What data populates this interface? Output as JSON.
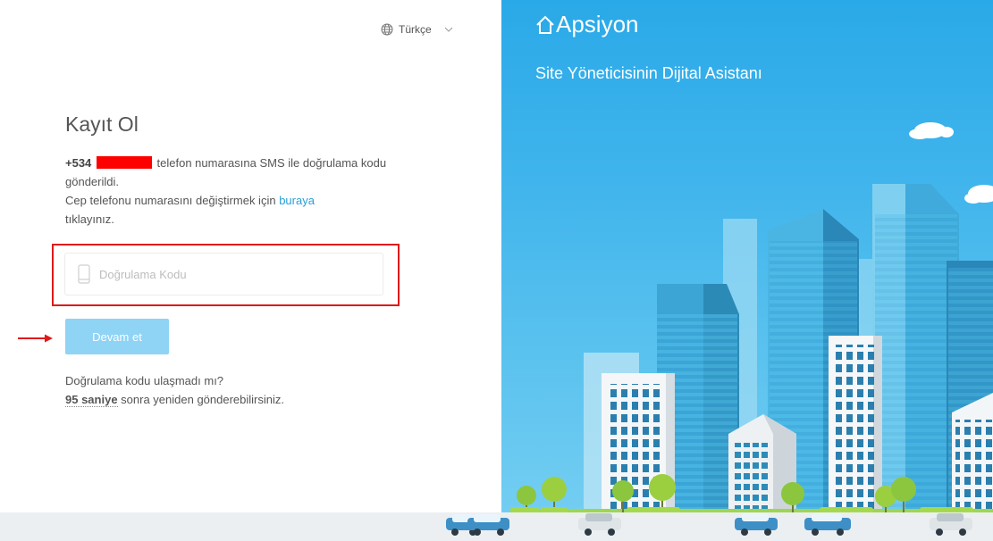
{
  "language": {
    "label": "Türkçe"
  },
  "form": {
    "title": "Kayıt Ol",
    "phone_prefix": "+534",
    "phone_message_tail": " telefon numarasına SMS ile doğrulama kodu gönderildi.",
    "change_text_before": "Cep telefonu numarasını değiştirmek için ",
    "change_link": "buraya",
    "change_text_after": " tıklayınız.",
    "code_placeholder": "Doğrulama Kodu",
    "code_value": "",
    "submit_label": "Devam et",
    "resend_question": "Doğrulama kodu ulaşmadı mı?",
    "resend_seconds": "95 saniye",
    "resend_tail": " sonra yeniden gönderebilirsiniz."
  },
  "hero": {
    "brand": "Apsiyon",
    "tagline": "Site Yöneticisinin Dijital Asistanı"
  },
  "colors": {
    "accent": "#2a9fd8",
    "button": "#8fd3f5",
    "highlight_box": "#e0191b",
    "hero_bg": "#2aa9e8"
  }
}
